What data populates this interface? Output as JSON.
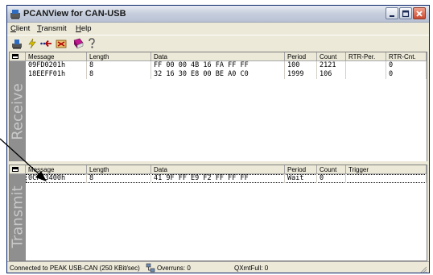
{
  "window": {
    "title": "PCANView for CAN-USB"
  },
  "menu": {
    "client": "lient",
    "client_key": "C",
    "transmit": "ransmit",
    "transmit_key": "T",
    "help": "elp",
    "help_key": "H"
  },
  "receive": {
    "label": "Receive",
    "headers": [
      "Message",
      "Length",
      "Data",
      "Period",
      "Count",
      "RTR-Per.",
      "RTR-Cnt."
    ],
    "rows": [
      [
        "09FD0201h",
        "8",
        "FF 00 00 4B 16 FA FF FF",
        "100",
        "2121",
        "",
        "0"
      ],
      [
        "18EEFF01h",
        "8",
        "32 16 30 E8 00 BE A0 C0",
        "1999",
        "106",
        "",
        "0"
      ]
    ]
  },
  "transmit": {
    "label": "Transmit",
    "headers": [
      "Message",
      "Length",
      "Data",
      "Period",
      "Count",
      "Trigger"
    ],
    "rows": [
      [
        "0CFF3400h",
        "8",
        "41 9F FF E9 F2 FF FF FF",
        "Wait",
        "0",
        ""
      ]
    ]
  },
  "status": {
    "connection": "Connected to PEAK USB-CAN (250 KBit/sec)",
    "overruns": "Overruns: 0",
    "qxmtfull": "QXmtFull: 0"
  }
}
